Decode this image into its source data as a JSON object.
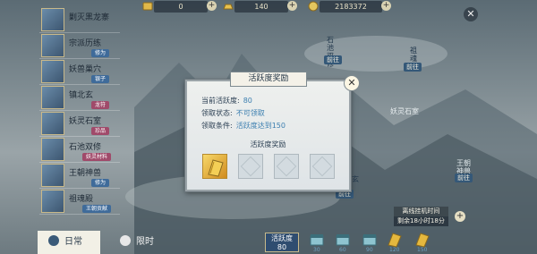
{
  "top_bar": {
    "resources": [
      {
        "icon": "ticket-icon",
        "value": "0"
      },
      {
        "icon": "gold-ingot-icon",
        "value": "140"
      },
      {
        "icon": "coin-icon",
        "value": "2183372"
      }
    ]
  },
  "left_list": {
    "items": [
      {
        "name": "剿灭黑龙寨",
        "tag": "",
        "tag_color": ""
      },
      {
        "name": "宗派历练",
        "tag": "修为",
        "tag_color": "#3f6b9a"
      },
      {
        "name": "妖兽巢穴",
        "tag": "银子",
        "tag_color": "#3f6b9a"
      },
      {
        "name": "镇北玄",
        "tag": "龙符",
        "tag_color": "#a04a6a"
      },
      {
        "name": "妖灵石室",
        "tag": "珍品",
        "tag_color": "#a04a6a"
      },
      {
        "name": "石池双修",
        "tag": "妖灵材料",
        "tag_color": "#a04a6a"
      },
      {
        "name": "王朝神兽",
        "tag": "修为",
        "tag_color": "#3f6b9a"
      },
      {
        "name": "祖魂殿",
        "tag": "王朝贡献",
        "tag_color": "#3f6b9a"
      }
    ]
  },
  "bottom_tabs": [
    {
      "label": "日常",
      "active": true
    },
    {
      "label": "限时",
      "active": false
    }
  ],
  "activity_bar": {
    "label": "活跃度",
    "value": "80"
  },
  "chest_milestones": [
    "30",
    "60",
    "90",
    "120",
    "150"
  ],
  "map_labels": [
    {
      "name": "石池双修",
      "goto": "前往"
    },
    {
      "name": "祖魂殿",
      "goto": "前往"
    },
    {
      "name": "妖灵石室",
      "goto": ""
    },
    {
      "name": "镇北玄",
      "goto": "前往"
    },
    {
      "name": "王朝神兽",
      "goto": "前往"
    }
  ],
  "hang_up": {
    "title": "离线挂机时间",
    "time_left": "剩余18小时18分"
  },
  "modal": {
    "title": "活跃度奖励",
    "current_label": "当前活跃度:",
    "current_value": "80",
    "status_label": "领取状态:",
    "status_value": "不可领取",
    "condition_label": "领取条件:",
    "condition_value": "活跃度达到150",
    "reward_title": "活跃度奖励",
    "slots": [
      {
        "icon": "gold-ticket-icon",
        "filled": true
      },
      {
        "icon": "empty-slot-icon",
        "filled": false
      },
      {
        "icon": "empty-slot-icon",
        "filled": false
      },
      {
        "icon": "empty-slot-icon",
        "filled": false
      }
    ]
  }
}
